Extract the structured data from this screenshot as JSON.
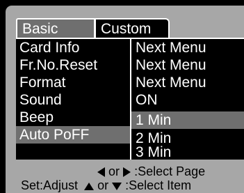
{
  "tabs": [
    {
      "label": "Basic",
      "active": true
    },
    {
      "label": "Custom",
      "active": false
    }
  ],
  "menu_items": [
    {
      "label": "Card Info"
    },
    {
      "label": "Fr.No.Reset"
    },
    {
      "label": "Format"
    },
    {
      "label": "Sound"
    },
    {
      "label": "Beep"
    },
    {
      "label": "Auto PoFF"
    }
  ],
  "values": [
    {
      "text": "Next Menu"
    },
    {
      "text": "Next Menu"
    },
    {
      "text": "Next Menu"
    },
    {
      "text": "ON"
    },
    {
      "text": "1 Min"
    },
    {
      "text": "2 Min"
    },
    {
      "text": "3 Min"
    }
  ],
  "footer": {
    "page_or": "or",
    "page_hint": ":Select Page",
    "set_adjust": "Set:Adjust",
    "item_or": "or",
    "item_hint": ":Select Item"
  },
  "colors": {
    "panel": "#a7a7a7",
    "selection": "#6f6f6f",
    "background": "#000000",
    "text": "#ffffff"
  }
}
